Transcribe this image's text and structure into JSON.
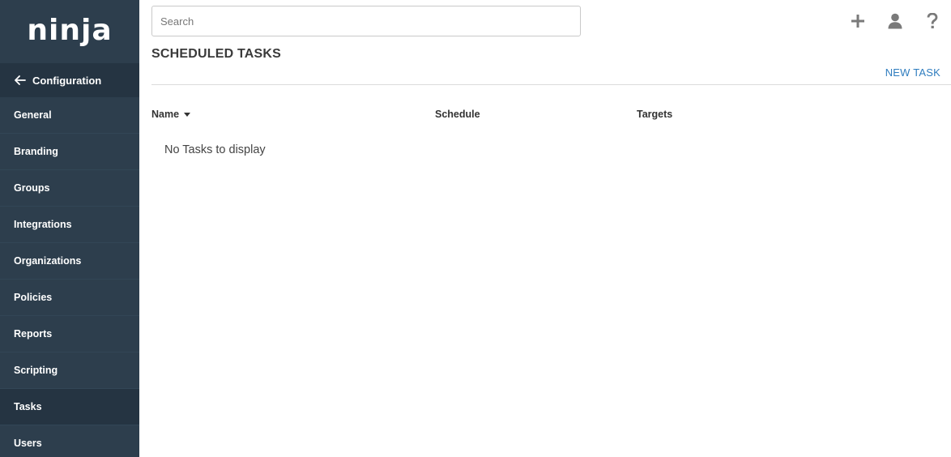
{
  "brand": {
    "logo_text": "ninja"
  },
  "sidebar": {
    "back_label": "Configuration",
    "items": [
      {
        "label": "General",
        "active": false
      },
      {
        "label": "Branding",
        "active": false
      },
      {
        "label": "Groups",
        "active": false
      },
      {
        "label": "Integrations",
        "active": false
      },
      {
        "label": "Organizations",
        "active": false
      },
      {
        "label": "Policies",
        "active": false
      },
      {
        "label": "Reports",
        "active": false
      },
      {
        "label": "Scripting",
        "active": false
      },
      {
        "label": "Tasks",
        "active": true
      },
      {
        "label": "Users",
        "active": false
      }
    ]
  },
  "header": {
    "search_placeholder": "Search",
    "icons": [
      "plus-icon",
      "user-icon",
      "help-icon"
    ]
  },
  "page": {
    "title": "SCHEDULED TASKS",
    "new_task_label": "NEW TASK"
  },
  "table": {
    "columns": [
      "Name",
      "Schedule",
      "Targets"
    ],
    "sort_column": "Name",
    "empty_message": "No Tasks to display"
  },
  "colors": {
    "sidebar_bg": "#2d3e4d",
    "sidebar_active_bg": "#253442",
    "link": "#2f7dbf",
    "icon": "#7a7a7a"
  }
}
